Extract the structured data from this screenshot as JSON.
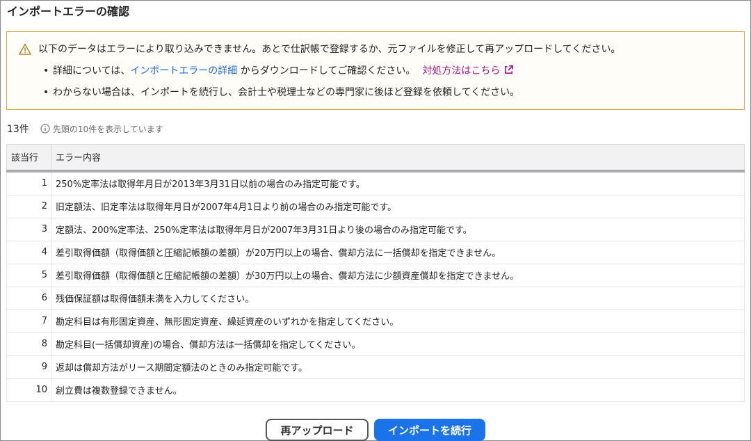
{
  "title": "インポートエラーの確認",
  "alert": {
    "icon": "warning-icon",
    "main_message": "以下のデータはエラーにより取り込みできません。あとで仕訳帳で登録するか、元ファイルを修正して再アップロードしてください。",
    "bullet1_prefix": "詳細については、",
    "bullet1_link": "インポートエラーの詳細",
    "bullet1_suffix": " からダウンロードしてご確認ください。",
    "bullet1_help_link": "対処方法はこちら",
    "bullet2": "わからない場合は、インポートを続行し、会計士や税理士などの専門家に後ほど登録を依頼してください。",
    "colors": {
      "border": "#d4a93a",
      "icon": "#c0862a",
      "link": "#1a68d6",
      "help_link": "#a8168c"
    }
  },
  "summary": {
    "count": "13件",
    "note": "先頭の10件を表示しています"
  },
  "table": {
    "headers": [
      "該当行",
      "エラー内容"
    ],
    "rows": [
      [
        "1",
        "250%定率法は取得年月日が2013年3月31日以前の場合のみ指定可能です。"
      ],
      [
        "2",
        "旧定額法、旧定率法は取得年月日が2007年4月1日より前の場合のみ指定可能です。"
      ],
      [
        "3",
        "定額法、200%定率法、250%定率法は取得年月日が2007年3月31日より後の場合のみ指定可能です。"
      ],
      [
        "4",
        "差引取得価額（取得価額と圧縮記帳額の差額）が20万円以上の場合、償却方法に一括償却を指定できません。"
      ],
      [
        "5",
        "差引取得価額（取得価額と圧縮記帳額の差額）が30万円以上の場合、償却方法に少額資産償却を指定できません。"
      ],
      [
        "6",
        "残価保証額は取得価額未満を入力してください。"
      ],
      [
        "7",
        "勘定科目は有形固定資産、無形固定資産、繰延資産のいずれかを指定してください。"
      ],
      [
        "8",
        "勘定科目(一括償却資産)の場合、償却方法は一括償却を指定してください。"
      ],
      [
        "9",
        "返却は償却方法がリース期間定額法のときのみ指定可能です。"
      ],
      [
        "10",
        "創立費は複数登録できません。"
      ]
    ]
  },
  "buttons": {
    "reupload": "再アップロード",
    "continue": "インポートを続行",
    "primary_color": "#1a73e8"
  }
}
